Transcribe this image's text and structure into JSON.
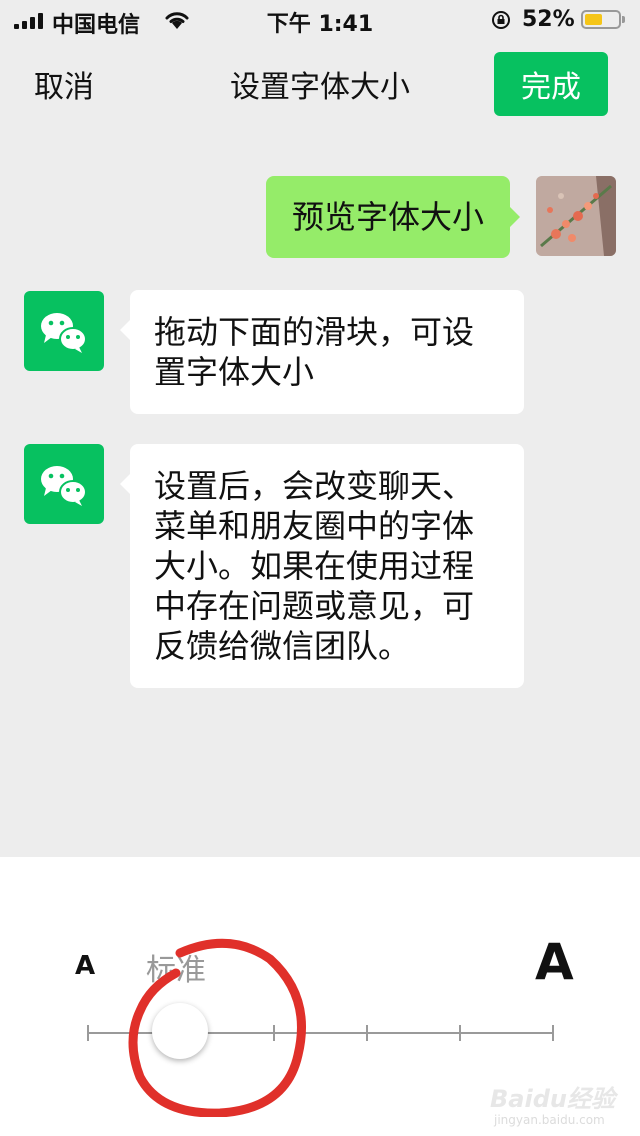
{
  "status_bar": {
    "carrier": "中国电信",
    "time": "下午 1:41",
    "battery_percent": "52%",
    "battery_level": 0.52,
    "battery_color": "#f5c518"
  },
  "nav": {
    "cancel": "取消",
    "title": "设置字体大小",
    "done": "完成",
    "done_color": "#07c160"
  },
  "messages": {
    "outgoing": {
      "text": "预览字体大小",
      "bubble_color": "#95ec69",
      "avatar": "user-photo-avatar"
    },
    "incoming": [
      {
        "text": "拖动下面的滑块，可设置字体大小",
        "avatar": "wechat-logo-icon"
      },
      {
        "text": "设置后，会改变聊天、菜单和朋友圈中的字体大小。如果在使用过程中存在问题或意见，可反馈给微信团队。",
        "avatar": "wechat-logo-icon"
      }
    ]
  },
  "font_size_slider": {
    "small_label": "A",
    "large_label": "A",
    "current_label": "标准",
    "steps": 6,
    "current_step": 1
  },
  "watermark": {
    "main": "Baidu经验",
    "sub": "jingyan.baidu.com"
  }
}
